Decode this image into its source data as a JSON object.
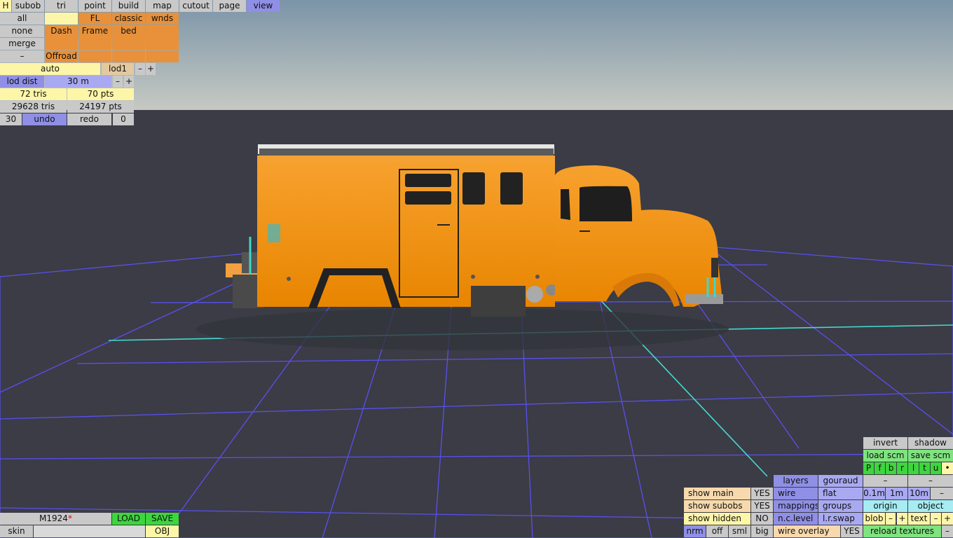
{
  "top_menu": {
    "h": "H",
    "subob": "subob",
    "tri": "tri",
    "point": "point",
    "build": "build",
    "map": "map",
    "cutout": "cutout",
    "page": "page",
    "view": "view"
  },
  "subobs": {
    "all": "all",
    "none": "none",
    "merge": "merge",
    "minus": "–",
    "fl": "FL",
    "classic": "classic",
    "wnds": "wnds",
    "dash": "Dash",
    "frame": "Frame",
    "bed": "bed",
    "offroad": "Offroad"
  },
  "lod": {
    "auto": "auto",
    "lod1": "lod1",
    "minus": "–",
    "plus": "+",
    "lod_dist_label": "lod dist",
    "lod_dist_value": "30 m"
  },
  "stats": {
    "tris": "72 tris",
    "pts": "70 pts",
    "total_tris": "29628 tris",
    "total_pts": "24197 pts"
  },
  "history": {
    "count": "30",
    "undo": "undo",
    "redo": "redo",
    "redo_count": "0"
  },
  "file": {
    "name": "M1924",
    "modified_mark": "*",
    "load": "LOAD",
    "save": "SAVE",
    "skin": "skin",
    "obj": "OBJ"
  },
  "view_panel": {
    "show_main": "show main",
    "show_main_val": "YES",
    "show_subobs": "show subobs",
    "show_subobs_val": "YES",
    "show_hidden": "show hidden",
    "show_hidden_val": "NO",
    "nrm": "nrm",
    "off": "off",
    "sml": "sml",
    "big": "big",
    "layers": "layers",
    "gouraud": "gouraud",
    "wire": "wire",
    "flat": "flat",
    "mappings": "mappings",
    "groups": "groups",
    "nc_level": "n.c.level",
    "lr_swap": "l.r.swap",
    "wire_overlay": "wire overlay",
    "wire_overlay_val": "YES",
    "invert": "invert",
    "shadow": "shadow",
    "load_scm": "load scm",
    "save_scm": "save scm",
    "flags": [
      "P",
      "f",
      "b",
      "r",
      "l",
      "t",
      "u",
      "•"
    ],
    "dash": "–",
    "step_01": "0.1m",
    "step_1": "1m",
    "step_10": "10m",
    "origin": "origin",
    "object": "object",
    "blob": "blob",
    "text": "text",
    "minus": "–",
    "plus": "+",
    "reload_textures": "reload textures"
  },
  "colors": {
    "sky_top": "#7d96a9",
    "sky_bottom": "#c3c7c2",
    "floor": "#3b3c45",
    "grid": "#5a4ff0",
    "axis": "#46d8d0",
    "truck": "#f08c12"
  }
}
